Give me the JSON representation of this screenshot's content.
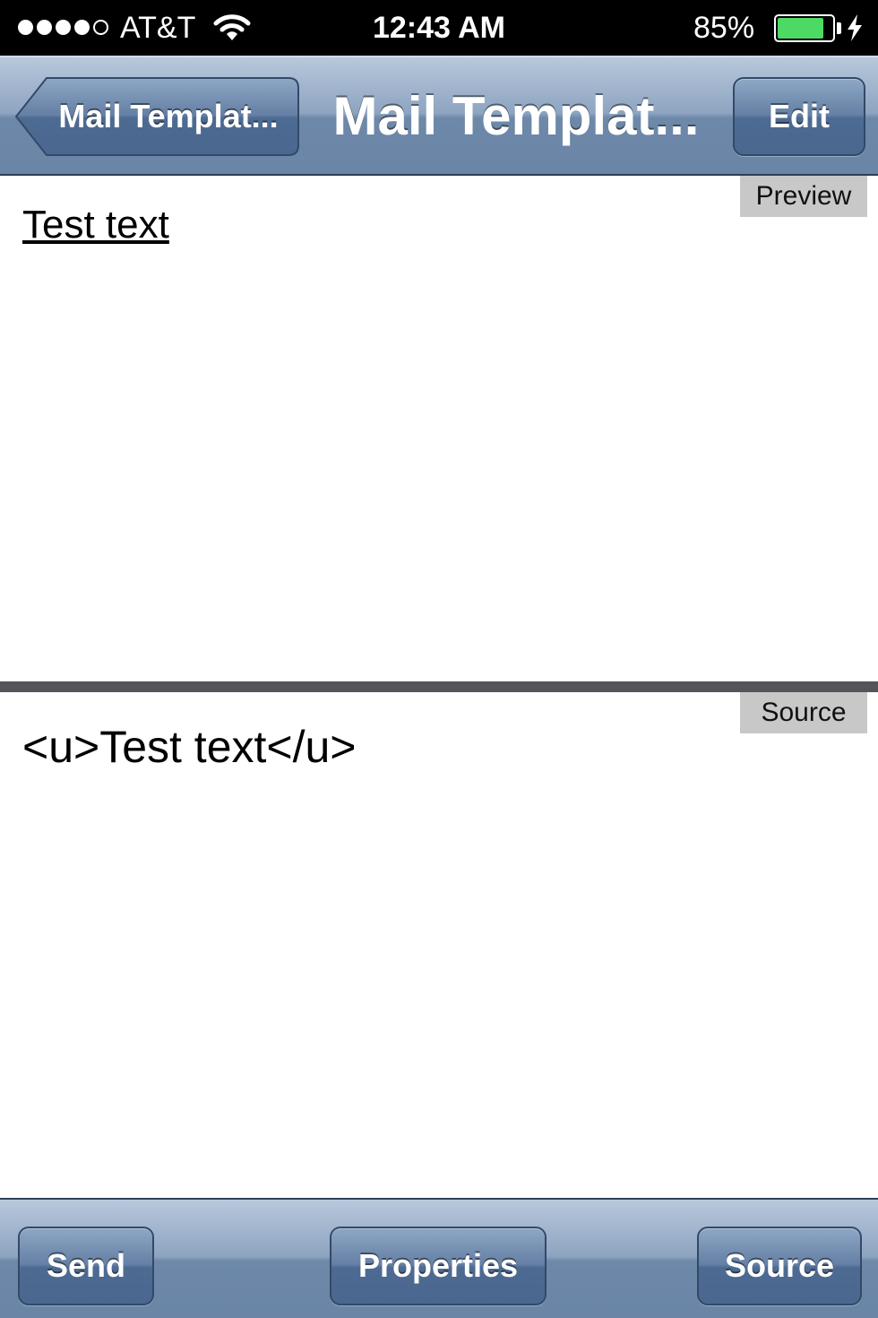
{
  "status_bar": {
    "signal_bars_filled": 4,
    "signal_bars_total": 5,
    "carrier": "AT&T",
    "time": "12:43 AM",
    "battery_percent": "85%",
    "battery_level": 0.85,
    "battery_color": "#4cd964",
    "wifi_icon": "wifi-icon",
    "charging_icon": "lightning-bolt-icon"
  },
  "nav_bar": {
    "back_label": "Mail Templat...",
    "title": "Mail Templat...",
    "edit_label": "Edit"
  },
  "preview_pane": {
    "tag": "Preview",
    "content": "Test text"
  },
  "source_pane": {
    "tag": "Source",
    "content": "<u>Test text</u>"
  },
  "toolbar": {
    "send_label": "Send",
    "properties_label": "Properties",
    "source_label": "Source"
  }
}
